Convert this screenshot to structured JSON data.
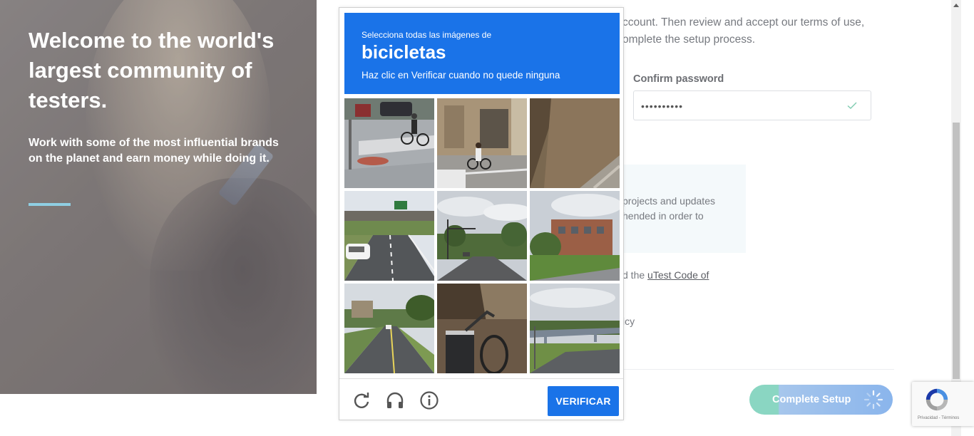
{
  "hero": {
    "title": "Welcome to the world's largest community of testers.",
    "subtitle": "Work with some of the most influential brands on the planet and earn money while doing it."
  },
  "form": {
    "intro_text": "ccount. Then review and accept our terms of use, omplete the setup process.",
    "confirm_password_label": "Confirm password",
    "confirm_password_value": "••••••••••",
    "notify_text": "projects and updates hended in order to",
    "code_prefix": "d the ",
    "code_link": "uTest Code of",
    "policy_text": "icy",
    "complete_setup_label": "Complete Setup"
  },
  "captcha": {
    "instruction_line1": "Selecciona todas las imágenes de",
    "target_object": "bicicletas",
    "instruction_line3": "Haz clic en Verificar cuando no quede ninguna",
    "tiles": [
      "street-crossing-cyclist",
      "building-cyclist",
      "street-curb",
      "highway-overpass",
      "road-intersection-trees",
      "brick-building-lawn",
      "suburban-road",
      "bicycle-basket-closeup",
      "highway-bridge"
    ],
    "reload_icon": "reload-icon",
    "audio_icon": "headphones-icon",
    "info_icon": "info-icon",
    "verify_label": "VERIFICAR"
  },
  "recaptcha_badge": {
    "privacy_terms": "Privacidad - Términos"
  },
  "colors": {
    "captcha_blue": "#1a73e8",
    "hero_accent": "#8fcfe3",
    "button_green": "#8ad6c2",
    "button_blue": "#8ab5ec"
  }
}
